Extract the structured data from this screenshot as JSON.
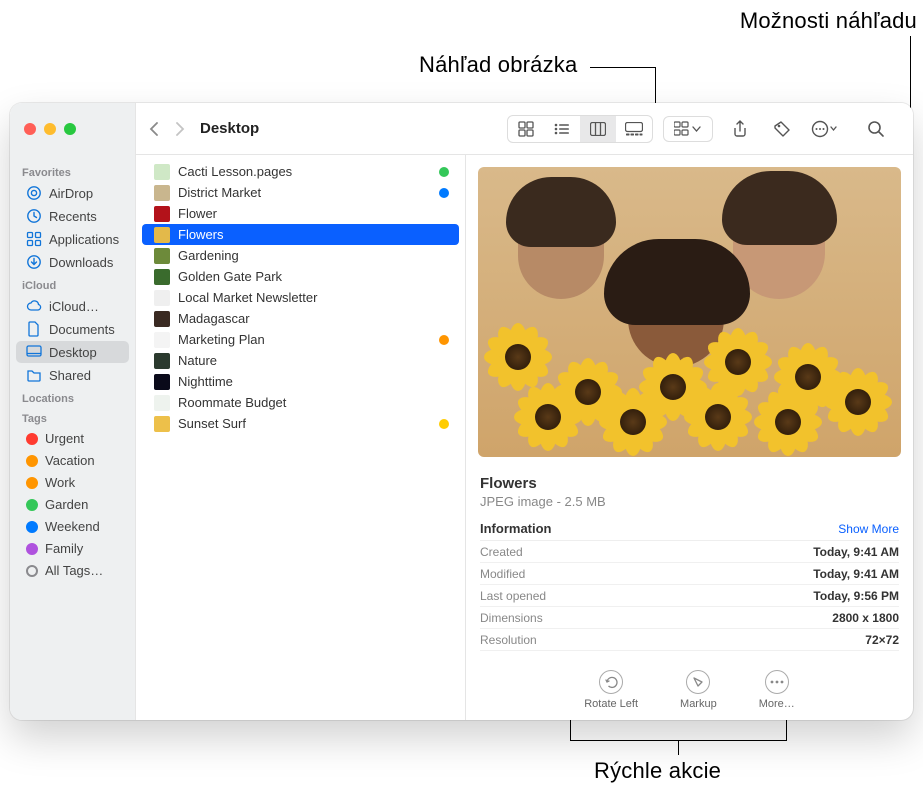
{
  "callouts": {
    "preview_options": "Možnosti náhľadu",
    "image_preview": "Náhľad obrázka",
    "quick_actions": "Rýchle akcie"
  },
  "window": {
    "title": "Desktop"
  },
  "traffic": {
    "close": "#ff5f57",
    "min": "#febc2e",
    "max": "#28c840"
  },
  "sidebar": {
    "sections": [
      {
        "header": "Favorites",
        "items": [
          {
            "label": "AirDrop",
            "icon": "airdrop"
          },
          {
            "label": "Recents",
            "icon": "clock"
          },
          {
            "label": "Applications",
            "icon": "apps"
          },
          {
            "label": "Downloads",
            "icon": "download"
          }
        ]
      },
      {
        "header": "iCloud",
        "items": [
          {
            "label": "iCloud…",
            "icon": "cloud"
          },
          {
            "label": "Documents",
            "icon": "doc"
          },
          {
            "label": "Desktop",
            "icon": "desktop",
            "sel": true
          },
          {
            "label": "Shared",
            "icon": "shared"
          }
        ]
      },
      {
        "header": "Locations",
        "items": []
      },
      {
        "header": "Tags",
        "items": [
          {
            "label": "Urgent",
            "tag": "#ff3b30"
          },
          {
            "label": "Vacation",
            "tag": "#ff9500"
          },
          {
            "label": "Work",
            "tag": "#ff9500"
          },
          {
            "label": "Garden",
            "tag": "#34c759"
          },
          {
            "label": "Weekend",
            "tag": "#007aff"
          },
          {
            "label": "Family",
            "tag": "#af52de"
          },
          {
            "label": "All Tags…",
            "tag": ""
          }
        ]
      }
    ]
  },
  "files": [
    {
      "name": "Cacti Lesson.pages",
      "thumb": "#cfe8c6",
      "dot": "#34c759"
    },
    {
      "name": "District Market",
      "thumb": "#c9b68e",
      "dot": "#007aff"
    },
    {
      "name": "Flower",
      "thumb": "#b3121a"
    },
    {
      "name": "Flowers",
      "thumb": "#e3b94a",
      "sel": true
    },
    {
      "name": "Gardening",
      "thumb": "#6d8a3a"
    },
    {
      "name": "Golden Gate Park",
      "thumb": "#3a6b2d"
    },
    {
      "name": "Local Market Newsletter",
      "thumb": "#efefef"
    },
    {
      "name": "Madagascar",
      "thumb": "#3a2a22"
    },
    {
      "name": "Marketing Plan",
      "thumb": "#f4f4f4",
      "dot": "#ff9500"
    },
    {
      "name": "Nature",
      "thumb": "#2b3a2e"
    },
    {
      "name": "Nighttime",
      "thumb": "#0a0a1a"
    },
    {
      "name": "Roommate Budget",
      "thumb": "#eef3ee"
    },
    {
      "name": "Sunset Surf",
      "thumb": "#edc04a",
      "dot": "#ffcc00"
    }
  ],
  "preview": {
    "title": "Flowers",
    "subtitle": "JPEG image - 2.5 MB",
    "info_header": "Information",
    "show_more": "Show More",
    "rows": [
      {
        "k": "Created",
        "v": "Today, 9:41 AM"
      },
      {
        "k": "Modified",
        "v": "Today, 9:41 AM"
      },
      {
        "k": "Last opened",
        "v": "Today, 9:56 PM"
      },
      {
        "k": "Dimensions",
        "v": "2800 x 1800"
      },
      {
        "k": "Resolution",
        "v": "72×72"
      }
    ],
    "actions": [
      {
        "label": "Rotate Left",
        "icon": "rotate"
      },
      {
        "label": "Markup",
        "icon": "markup"
      },
      {
        "label": "More…",
        "icon": "more"
      }
    ]
  }
}
